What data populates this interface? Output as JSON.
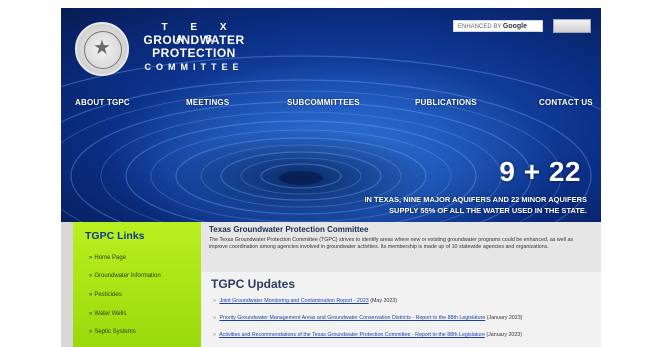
{
  "header": {
    "logo": {
      "line1": "T E X A S",
      "line2": "GROUNDWATER",
      "line3": "PROTECTION",
      "line4": "COMMITTEE"
    },
    "search": {
      "placeholder": "ENHANCED BY",
      "brand": "Google"
    },
    "nav": [
      {
        "label": "ABOUT TGPC"
      },
      {
        "label": "MEETINGS"
      },
      {
        "label": "SUBCOMMITTEES"
      },
      {
        "label": "PUBLICATIONS"
      },
      {
        "label": "CONTACT US"
      }
    ],
    "hero": {
      "number": "9 + 22",
      "tagline_line1": "IN TEXAS, NINE MAJOR AQUIFERS AND 22 MINOR AQUIFERS",
      "tagline_line2": "SUPPLY 55% OF ALL THE WATER USED IN THE STATE."
    }
  },
  "sidebar": {
    "title": "TGPC Links",
    "items": [
      {
        "label": "Home Page"
      },
      {
        "label": "Groundwater Information"
      },
      {
        "label": "Pesticides"
      },
      {
        "label": "Water Wells"
      },
      {
        "label": "Septic Systems"
      }
    ]
  },
  "intro": {
    "title": "Texas Groundwater Protection Committee",
    "body": "The Texas Groundwater Protection Committee (TGPC) strives to identify areas where new or existing groundwater programs could be enhanced, as well as improve coordination among agencies involved in groundwater activities. Its membership is made up of 10 statewide agencies and organizations."
  },
  "updates": {
    "title": "TGPC Updates",
    "items": [
      {
        "link": "Joint Groundwater Monitoring and Contamination Report - 2023",
        "note": "(May 2023)"
      },
      {
        "link": "Priority Groundwater Management Areas and Groundwater Conservation Districts - Report to the 88th Legislature",
        "note": "(January 2023)"
      },
      {
        "link": "Activities and Recommendations of the Texas Groundwater Protection Committee - Report to the 88th Legislature",
        "note": "(January 2023)"
      }
    ]
  },
  "colors": {
    "banner_blue": "#1c58c0",
    "sidebar_green": "#b9f020",
    "link_blue": "#1c3fae"
  }
}
